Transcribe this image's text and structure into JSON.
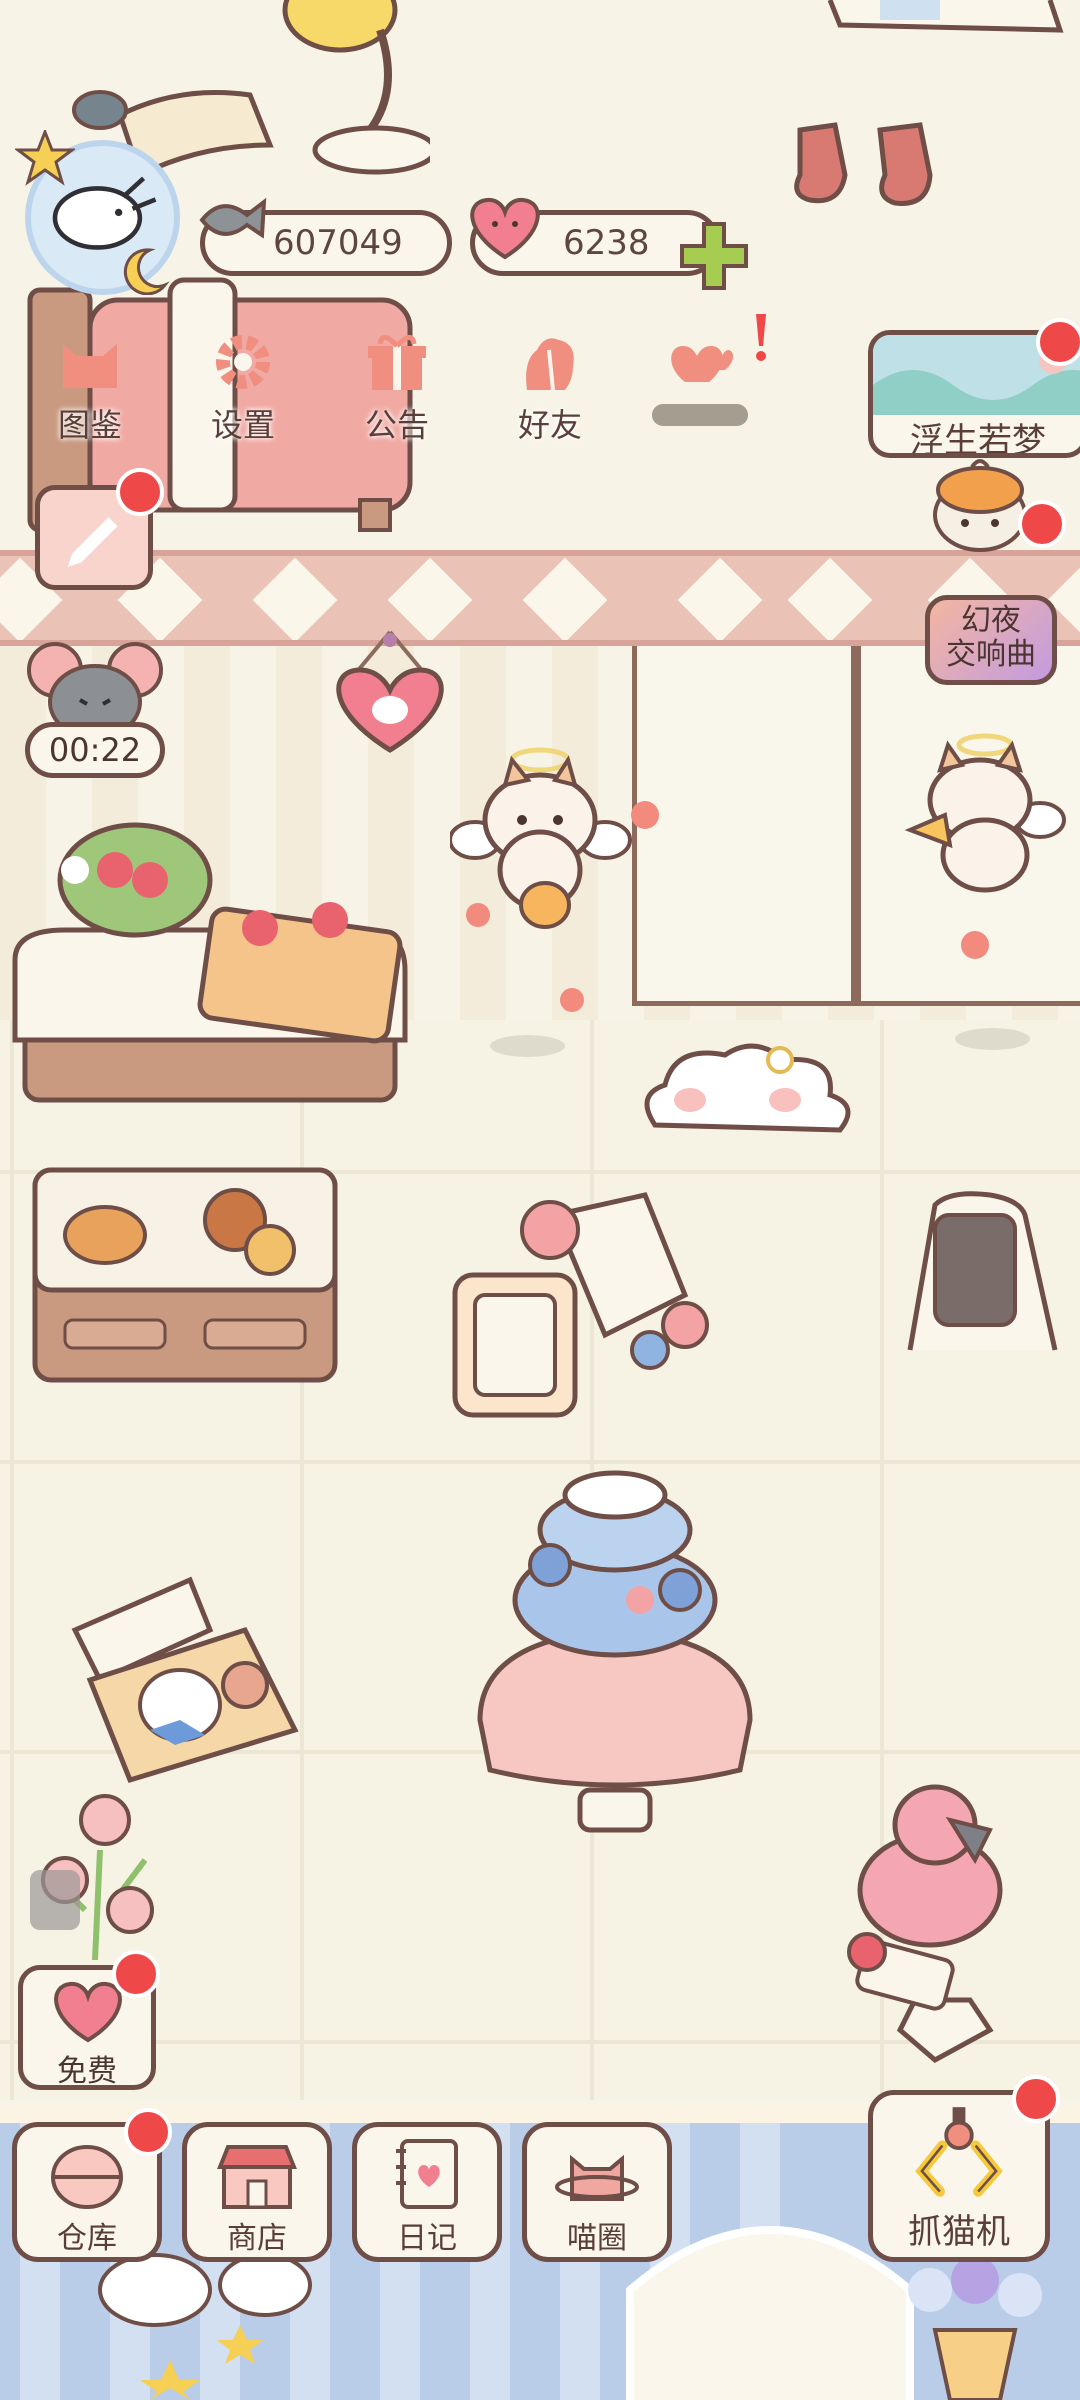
{
  "resources": {
    "fish_amount": "607049",
    "heart_amount": "6238"
  },
  "top_menu": {
    "collection": "图鉴",
    "settings": "设置",
    "notice": "公告",
    "friends": "好友"
  },
  "events": {
    "dream_event": "浮生若梦",
    "night_event_line1": "幻夜",
    "night_event_line2": "交响曲"
  },
  "timer": "00:22",
  "free_reward": "免费",
  "bottom_nav": {
    "warehouse": "仓库",
    "shop": "商店",
    "diary": "日记",
    "cat_circle": "喵圈",
    "claw_machine": "抓猫机"
  },
  "colors": {
    "accent_pink": "#f08f7f",
    "notification_red": "#ef4848",
    "outline_brown": "#6e4e47",
    "plus_green": "#a6cc52"
  }
}
